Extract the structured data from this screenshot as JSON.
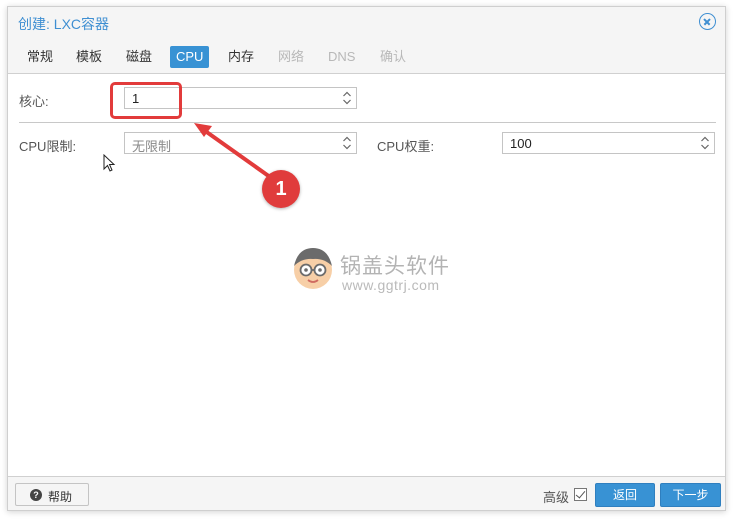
{
  "dialog": {
    "title": "创建: LXC容器"
  },
  "tabs": [
    {
      "label": "常规",
      "state": "normal"
    },
    {
      "label": "模板",
      "state": "normal"
    },
    {
      "label": "磁盘",
      "state": "normal"
    },
    {
      "label": "CPU",
      "state": "active"
    },
    {
      "label": "内存",
      "state": "normal"
    },
    {
      "label": "网络",
      "state": "disabled"
    },
    {
      "label": "DNS",
      "state": "disabled"
    },
    {
      "label": "确认",
      "state": "disabled"
    }
  ],
  "form": {
    "cores": {
      "label": "核心:",
      "value": "1"
    },
    "cpu_limit": {
      "label": "CPU限制:",
      "value": "无限制"
    },
    "cpu_units": {
      "label": "CPU权重:",
      "value": "100"
    }
  },
  "annotation": {
    "number": "1",
    "color": "#e03c3c"
  },
  "watermark": {
    "text": "锅盖头软件",
    "url": "www.ggtrj.com"
  },
  "footer": {
    "help_label": "帮助",
    "advanced_label": "高级",
    "advanced_checked": true,
    "back_label": "返回",
    "next_label": "下一步"
  },
  "colors": {
    "accent": "#3892d4",
    "title": "#3f8fd2",
    "annotation": "#e23b3b"
  },
  "icons": {
    "close": "close-circle-icon",
    "help": "question-circle-icon",
    "spinner": "spinner-arrows-icon",
    "cursor": "mouse-cursor-icon"
  }
}
